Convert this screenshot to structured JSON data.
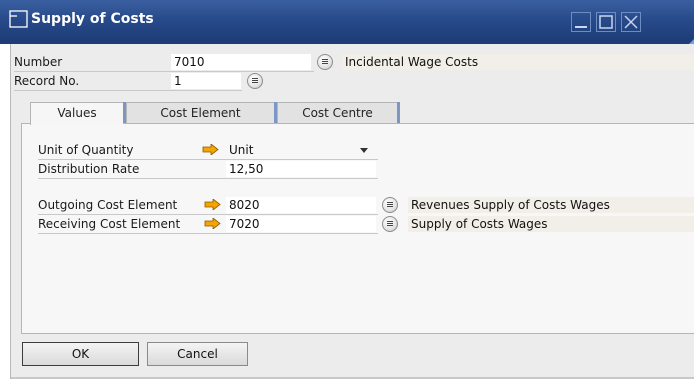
{
  "window": {
    "title": "Supply of Costs"
  },
  "header": {
    "number_label": "Number",
    "number_value": "7010",
    "number_description": "Incidental Wage Costs",
    "record_label": "Record No.",
    "record_value": "1"
  },
  "tabs": [
    {
      "label": "Values",
      "active": true
    },
    {
      "label": "Cost Element",
      "active": false
    },
    {
      "label": "Cost Centre",
      "active": false
    }
  ],
  "values_tab": {
    "unit_label": "Unit of Quantity",
    "unit_value": "Unit",
    "rate_label": "Distribution Rate",
    "rate_value": "12,50",
    "outgoing_label": "Outgoing Cost Element",
    "outgoing_value": "8020",
    "outgoing_description": "Revenues Supply of Costs Wages",
    "receiving_label": "Receiving Cost Element",
    "receiving_value": "7020",
    "receiving_description": "Supply of Costs Wages"
  },
  "buttons": {
    "ok": "OK",
    "cancel": "Cancel"
  },
  "icons": {
    "window": "window-icon",
    "link": "link-arrow-icon",
    "choose": "choose-list-icon",
    "dropdown": "chevron-down-icon"
  },
  "colors": {
    "titlebar": "#274a8a",
    "arrow": "#f5a400",
    "accent_tab": "#7c97c4"
  }
}
